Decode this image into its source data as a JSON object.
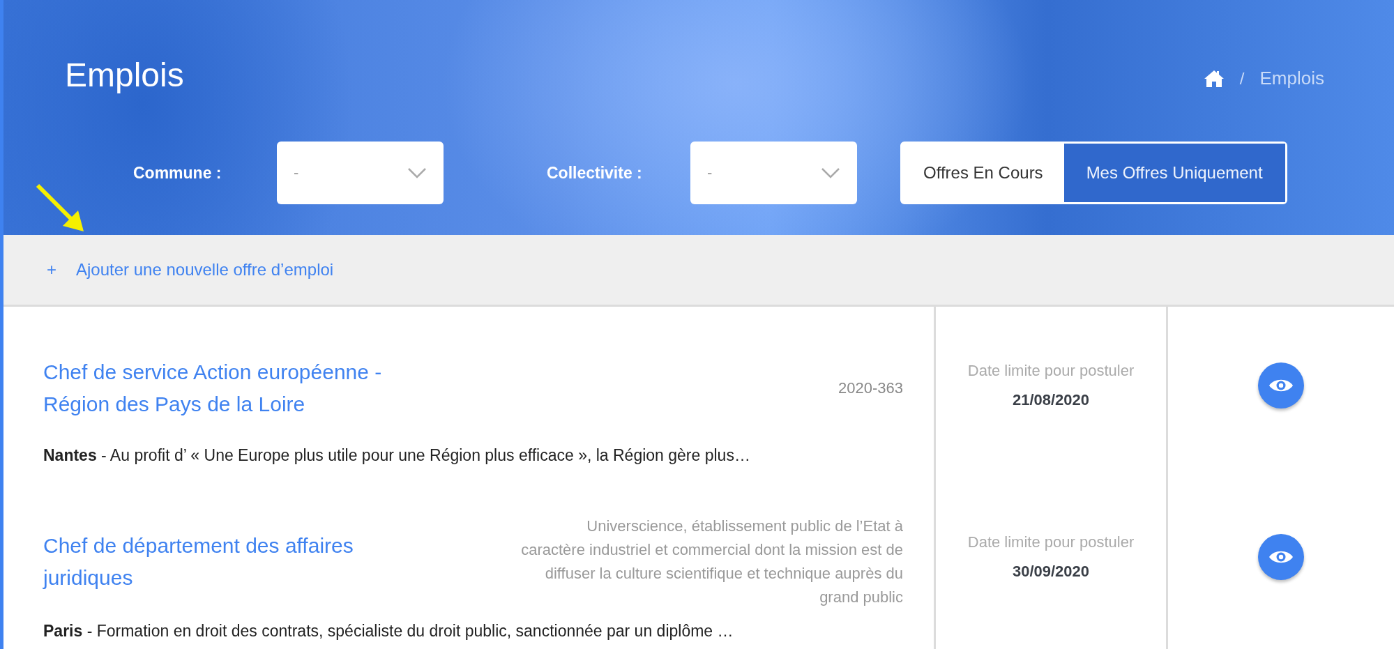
{
  "header": {
    "title": "Emplois",
    "breadcrumb": {
      "current": "Emplois",
      "separator": "/"
    }
  },
  "filters": [
    {
      "label": "Commune :",
      "value": "-"
    },
    {
      "label": "Collectivite :",
      "value": "-"
    }
  ],
  "view_toggle": [
    {
      "label": "Offres En Cours",
      "selected": false
    },
    {
      "label": "Mes Offres Uniquement",
      "selected": true
    }
  ],
  "add_link": {
    "icon": "+",
    "label": "Ajouter une nouvelle offre d’emploi"
  },
  "offers": [
    {
      "title": "Chef de service Action européenne - Région des Pays de la Loire",
      "reference": "2020-363",
      "summary": "**Nantes** - Au profit d’ « Une Europe plus utile pour une Région plus efficace », la Région gère plus…",
      "deadline": "Date limite pour postuler **21/08/2020**"
    },
    {
      "title": "Chef de département des affaires juridiques",
      "organization": "Universcience, établissement public de l’Etat à caractère industriel et commercial dont la mission est de diffuser la culture scientifique et technique auprès du grand public",
      "summary": "**Paris** - Formation en droit des contrats, spécialiste du droit public, sanctionnée par un diplôme …",
      "deadline": "Date limite pour postuler **30/09/2020**"
    }
  ]
}
